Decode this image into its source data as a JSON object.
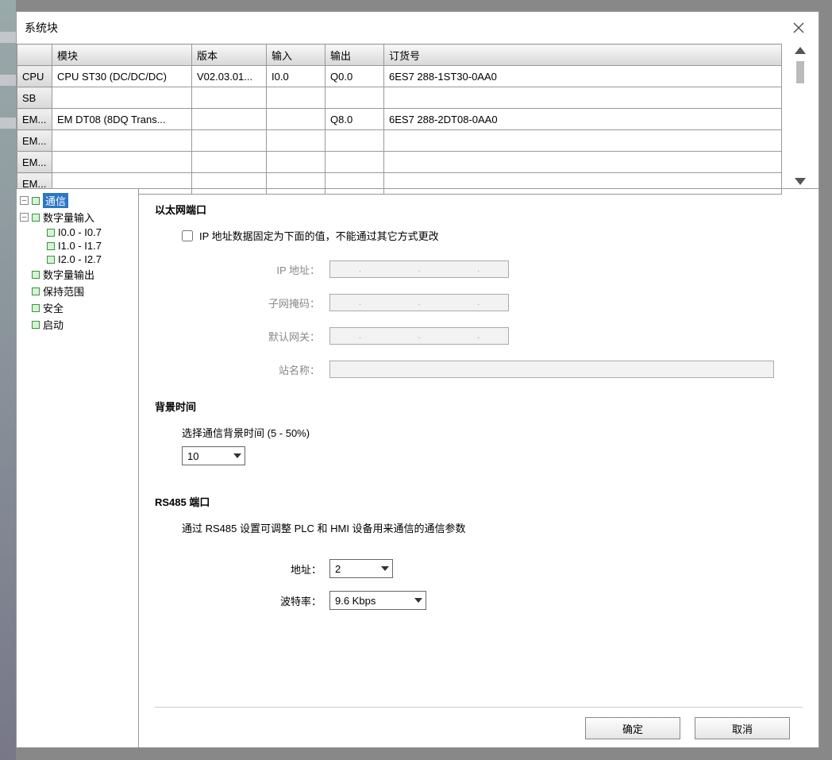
{
  "window": {
    "title": "系统块"
  },
  "table": {
    "headers": {
      "module": "模块",
      "version": "版本",
      "input": "输入",
      "output": "输出",
      "order": "订货号"
    },
    "rows": [
      {
        "slot": "CPU",
        "module": "CPU ST30 (DC/DC/DC)",
        "version": "V02.03.01...",
        "input": "I0.0",
        "output": "Q0.0",
        "order": "6ES7 288-1ST30-0AA0"
      },
      {
        "slot": "SB",
        "module": "",
        "version": "",
        "input": "",
        "output": "",
        "order": ""
      },
      {
        "slot": "EM...",
        "module": "EM DT08 (8DQ Trans...",
        "version": "",
        "input": "",
        "output": "Q8.0",
        "order": "6ES7 288-2DT08-0AA0"
      },
      {
        "slot": "EM...",
        "module": "",
        "version": "",
        "input": "",
        "output": "",
        "order": ""
      },
      {
        "slot": "EM...",
        "module": "",
        "version": "",
        "input": "",
        "output": "",
        "order": ""
      },
      {
        "slot": "EM...",
        "module": "",
        "version": "",
        "input": "",
        "output": "",
        "order": ""
      }
    ]
  },
  "tree": {
    "comm": "通信",
    "di": "数字量输入",
    "di_ranges": [
      "I0.0 - I0.7",
      "I1.0 - I1.7",
      "I2.0 - I2.7"
    ],
    "do_": "数字量输出",
    "retain": "保持范围",
    "security": "安全",
    "startup": "启动"
  },
  "eth": {
    "title": "以太网端口",
    "fixed_ip_label": "IP 地址数据固定为下面的值，不能通过其它方式更改",
    "ip_label": "IP 地址：",
    "mask_label": "子网掩码：",
    "gw_label": "默认网关：",
    "station_label": "站名称："
  },
  "bg": {
    "title": "背景时间",
    "desc": "选择通信背景时间 (5 - 50%)",
    "value": "10"
  },
  "rs": {
    "title": "RS485 端口",
    "desc": "通过 RS485 设置可调整 PLC 和 HMI 设备用来通信的通信参数",
    "addr_label": "地址：",
    "addr_value": "2",
    "baud_label": "波特率：",
    "baud_value": "9.6 Kbps"
  },
  "buttons": {
    "ok": "确定",
    "cancel": "取消"
  }
}
